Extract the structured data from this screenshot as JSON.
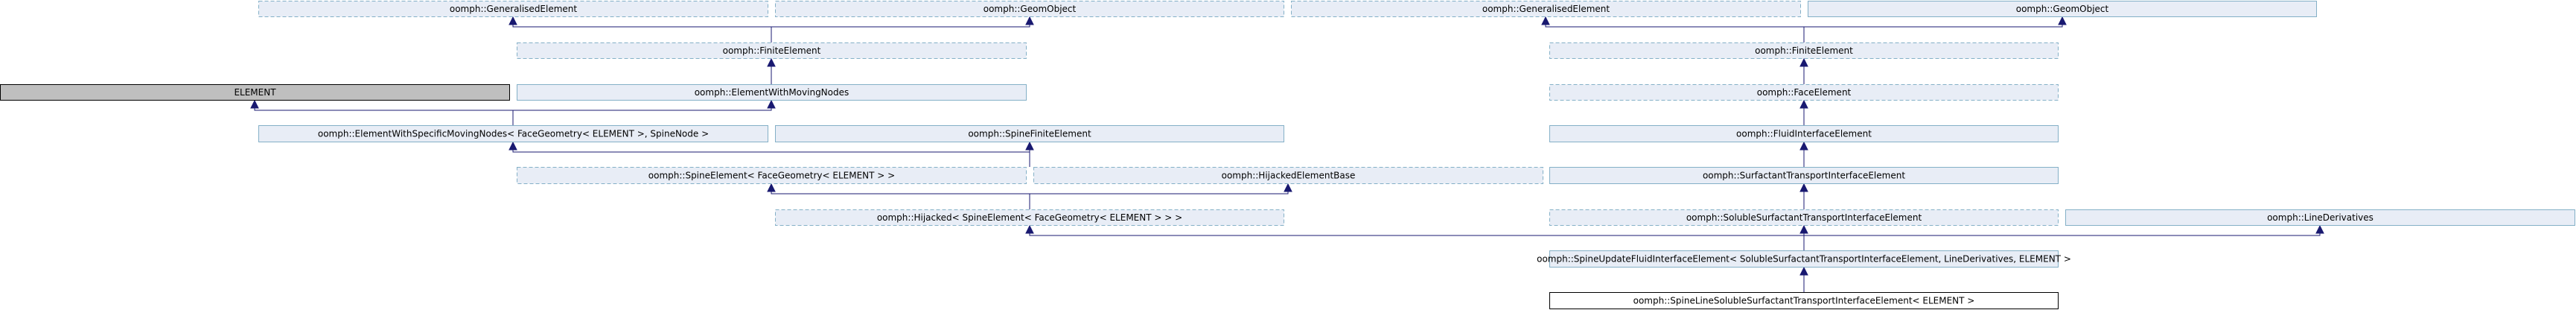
{
  "colors": {
    "edge": "#191970",
    "node_border": "#84b0c7",
    "node_fill": "#e8edf6",
    "element_fill": "#bfbfbf",
    "element_border": "#000000",
    "focus_fill": "#ffffff",
    "focus_border": "#000000"
  },
  "nodes": {
    "generalised_1": {
      "label": "oomph::GeneralisedElement",
      "style": "dashed"
    },
    "geomobject_1": {
      "label": "oomph::GeomObject",
      "style": "dashed"
    },
    "generalised_2": {
      "label": "oomph::GeneralisedElement",
      "style": "dashed"
    },
    "geomobject_2": {
      "label": "oomph::GeomObject",
      "style": "solid"
    },
    "finite_1": {
      "label": "oomph::FiniteElement",
      "style": "dashed"
    },
    "finite_2": {
      "label": "oomph::FiniteElement",
      "style": "dashed"
    },
    "element": {
      "label": "ELEMENT",
      "style": "gray"
    },
    "moving_nodes": {
      "label": "oomph::ElementWithMovingNodes",
      "style": "solid"
    },
    "face_element": {
      "label": "oomph::FaceElement",
      "style": "dashed"
    },
    "specific_moving": {
      "label": "oomph::ElementWithSpecificMovingNodes< FaceGeometry< ELEMENT >, SpineNode >",
      "style": "solid"
    },
    "spine_finite": {
      "label": "oomph::SpineFiniteElement",
      "style": "solid"
    },
    "fluid_interface": {
      "label": "oomph::FluidInterfaceElement",
      "style": "solid"
    },
    "spine_element": {
      "label": "oomph::SpineElement< FaceGeometry< ELEMENT > >",
      "style": "dashed"
    },
    "hijacked_base": {
      "label": "oomph::HijackedElementBase",
      "style": "dashed"
    },
    "surfactant": {
      "label": "oomph::SurfactantTransportInterfaceElement",
      "style": "solid"
    },
    "hijacked": {
      "label": "oomph::Hijacked< SpineElement< FaceGeometry< ELEMENT > > >",
      "style": "dashed"
    },
    "soluble": {
      "label": "oomph::SolubleSurfactantTransportInterfaceElement",
      "style": "dashed"
    },
    "line_derivatives": {
      "label": "oomph::LineDerivatives",
      "style": "solid"
    },
    "spine_update": {
      "label": "oomph::SpineUpdateFluidInterfaceElement< SolubleSurfactantTransportInterfaceElement, LineDerivatives, ELEMENT >",
      "style": "solid"
    },
    "spine_line": {
      "label": "oomph::SpineLineSolubleSurfactantTransportInterfaceElement< ELEMENT >",
      "style": "focus"
    }
  }
}
